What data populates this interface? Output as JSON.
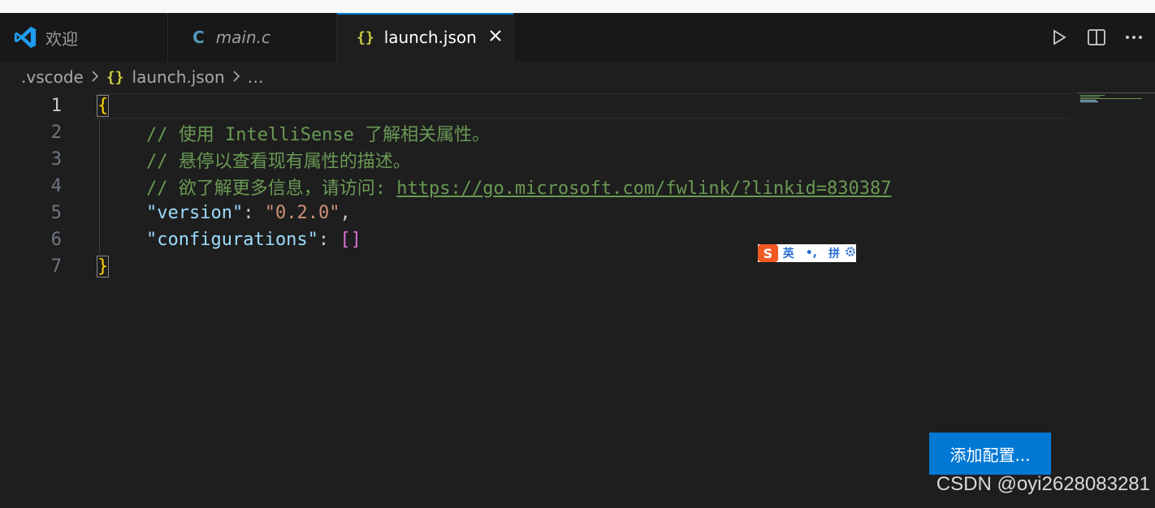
{
  "tabs": [
    {
      "label": "欢迎",
      "icon": "vscode-logo-icon",
      "active": false
    },
    {
      "label": "main.c",
      "icon": "c-file-icon",
      "icon_text": "C",
      "active": false,
      "italic": true
    },
    {
      "label": "launch.json",
      "icon": "json-file-icon",
      "icon_text": "{}",
      "active": true
    }
  ],
  "tab_actions": [
    "run-icon",
    "split-editor-icon",
    "more-actions-icon"
  ],
  "breadcrumb": {
    "folder": ".vscode",
    "json_icon": "{}",
    "file": "launch.json",
    "ellipsis": "…"
  },
  "editor": {
    "line_numbers": [
      "1",
      "2",
      "3",
      "4",
      "5",
      "6",
      "7"
    ],
    "lines": {
      "l1_brace": "{",
      "l2_comment": "// 使用 IntelliSense 了解相关属性。",
      "l3_comment": "// 悬停以查看现有属性的描述。",
      "l4_comment": "// 欲了解更多信息，请访问: ",
      "l4_link": "https://go.microsoft.com/fwlink/?linkid=830387",
      "l5_key": "\"version\"",
      "l5_colon": ": ",
      "l5_value": "\"0.2.0\"",
      "l5_comma": ",",
      "l6_key": "\"configurations\"",
      "l6_colon": ": ",
      "l6_value": "[]",
      "l7_brace": "}"
    }
  },
  "ime": {
    "logo": "S",
    "mode": "英",
    "punct": "•,",
    "pinyin": "拼",
    "settings_icon": "gear-icon"
  },
  "add_config_label": "添加配置...",
  "watermark": "CSDN @oyi2628083281",
  "colors": {
    "accent": "#0078d4",
    "comment": "#6a9955",
    "key": "#9cdcfe",
    "string": "#ce9178",
    "brace": "#ffd700",
    "bracket": "#da70d6"
  }
}
